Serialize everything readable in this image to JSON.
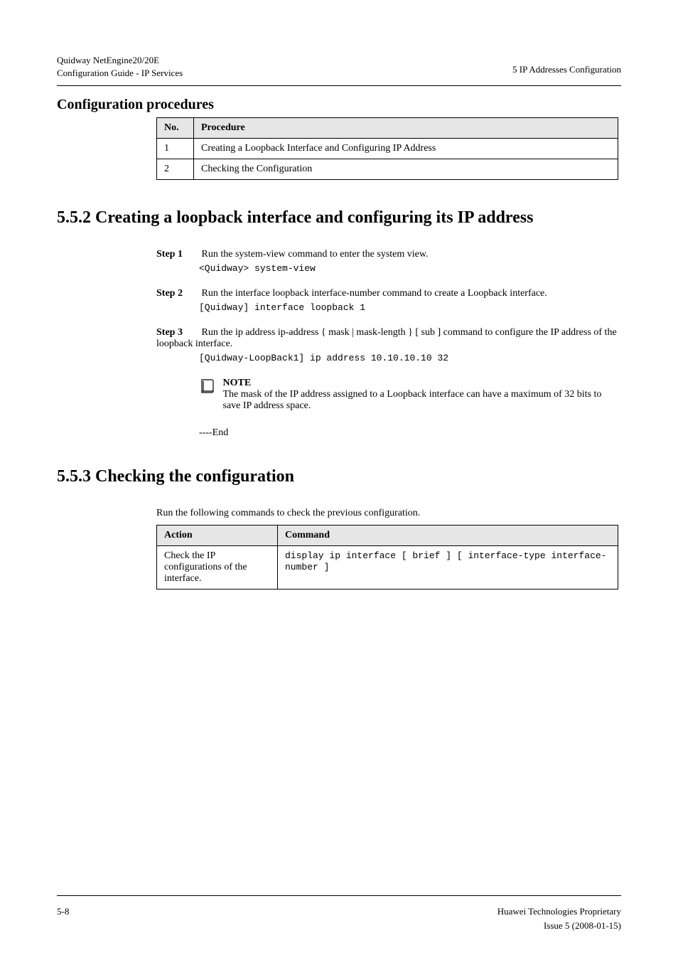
{
  "header": {
    "model_line1": "Quidway NetEngine20/20E",
    "model_line2": "Configuration Guide - IP Services",
    "chapter": "5 IP Addresses Configuration"
  },
  "footer": {
    "left": "5-8",
    "right_top": "Huawei Technologies Proprietary",
    "right_bottom": "Issue 5 (2008-01-15)"
  },
  "config_procedures": {
    "title": "Configuration procedures",
    "col_no": "No.",
    "col_proc": "Procedure",
    "rows": [
      {
        "no": "1",
        "proc": "Creating a Loopback Interface and Configuring IP Address"
      },
      {
        "no": "2",
        "proc": "Checking the Configuration"
      }
    ]
  },
  "section2": {
    "title": "5.5.2 Creating a loopback interface and configuring its IP address",
    "steps": [
      {
        "label": "Step 1",
        "body": "Run the system-view command to enter the system view.",
        "code": "<Quidway> system-view"
      },
      {
        "label": "Step 2",
        "body": "Run the interface loopback interface-number command to create a Loopback interface.",
        "code": "[Quidway] interface loopback 1"
      },
      {
        "label": "Step 3",
        "body": "Run the ip address ip-address { mask | mask-length } [ sub ] command to configure the IP address of the loopback interface.",
        "code": "[Quidway-LoopBack1] ip address 10.10.10.10 32"
      }
    ],
    "note": {
      "label": "NOTE",
      "body": "The mask of the IP address assigned to a Loopback interface can have a maximum of 32 bits to save IP address space."
    },
    "end": "----End"
  },
  "section3": {
    "title": "5.5.3 Checking the configuration",
    "intro": "Run the following commands to check the previous configuration.",
    "col_action": "Action",
    "col_command": "Command",
    "rows": [
      {
        "action": "Check the IP configurations of the interface.",
        "command": "display ip interface [ brief ] [ interface-type interface-number ]"
      }
    ]
  }
}
